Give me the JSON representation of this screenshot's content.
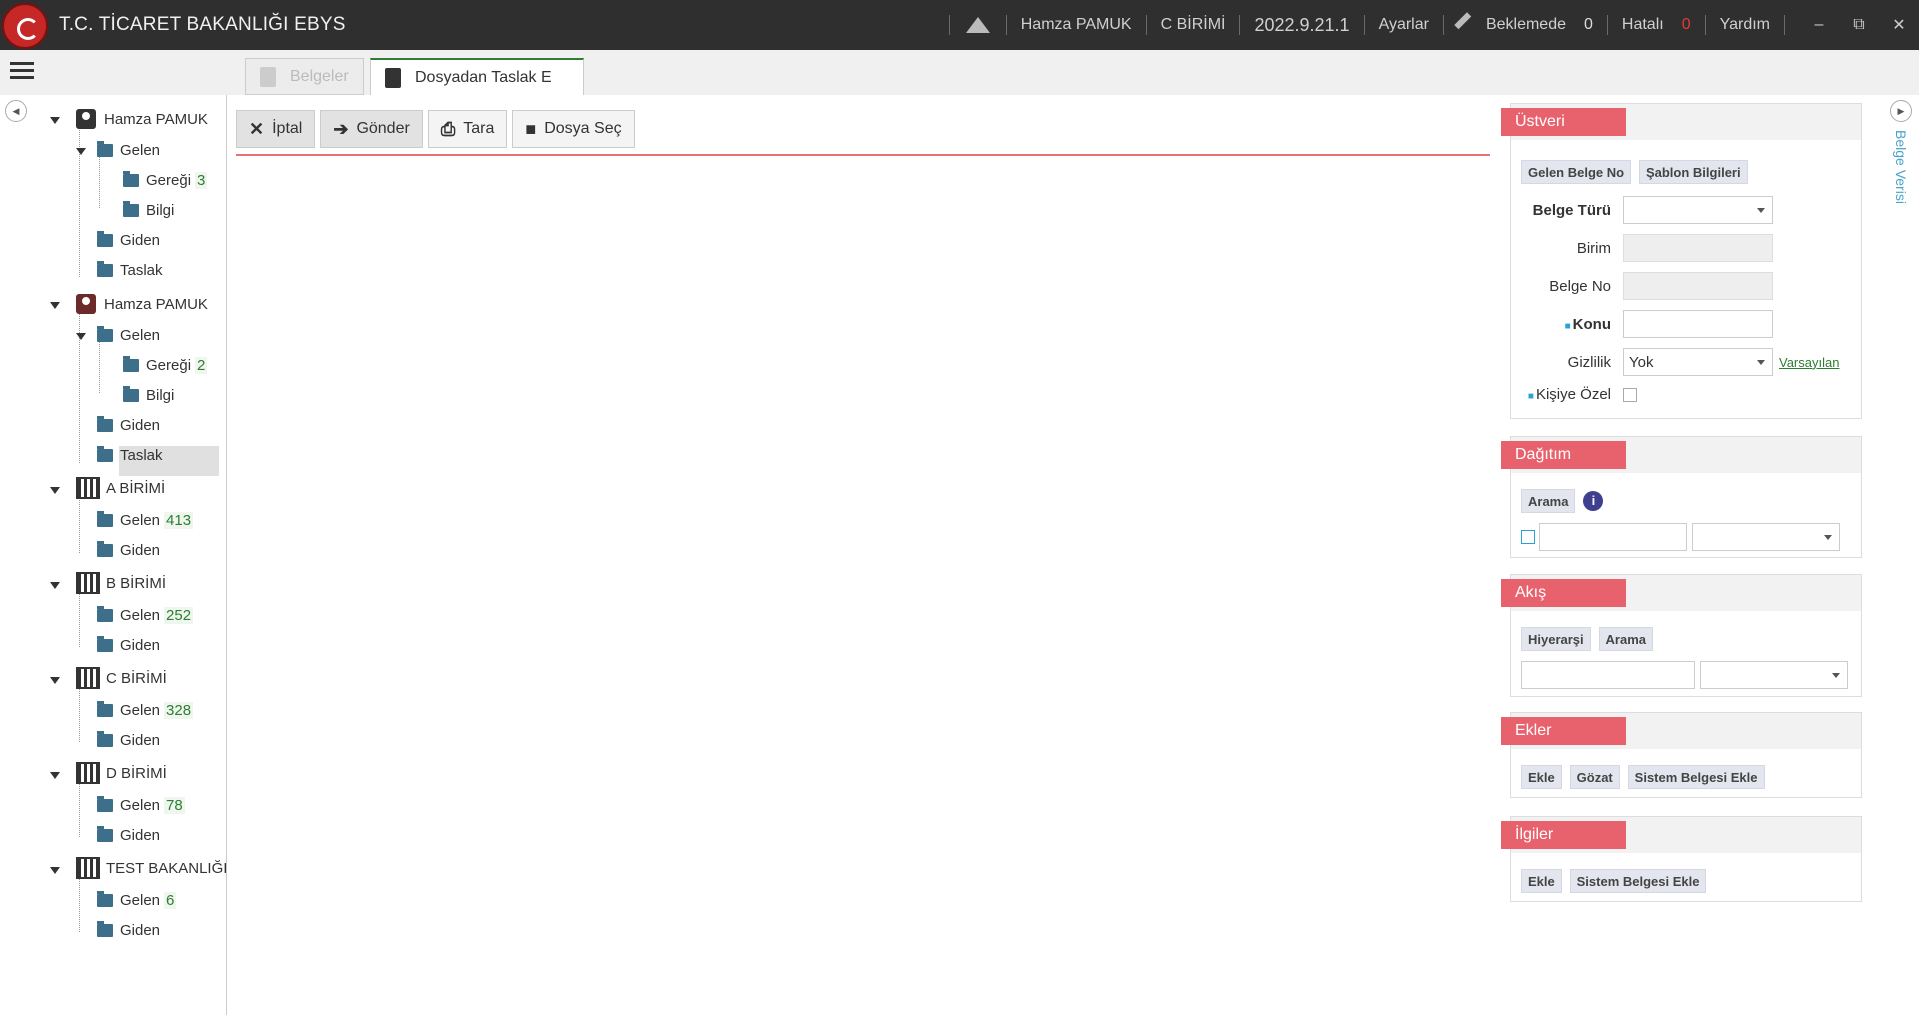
{
  "header": {
    "title": "T.C. TİCARET BAKANLIĞI EBYS",
    "user": "Hamza PAMUK",
    "unit": "C BİRİMİ",
    "version": "2022.9.21.1",
    "settings": "Ayarlar",
    "pending_label": "Beklemede",
    "pending_count": "0",
    "error_label": "Hatalı",
    "error_count": "0",
    "help": "Yardım",
    "minimize": "–",
    "restore": "⧉",
    "close": "✕"
  },
  "tabs": [
    {
      "label": "Belgeler"
    },
    {
      "label": "Dosyadan Taslak E"
    }
  ],
  "tree": {
    "user1": "Hamza PAMUK",
    "user2": "Hamza PAMUK",
    "gelen": "Gelen",
    "geregi": "Gereği",
    "bilgi": "Bilgi",
    "giden": "Giden",
    "taslak": "Taslak",
    "geregi1_count": "3",
    "geregi2_count": "2",
    "units": [
      {
        "name": "A BİRİMİ",
        "gelen_count": "413"
      },
      {
        "name": "B BİRİMİ",
        "gelen_count": "252"
      },
      {
        "name": "C BİRİMİ",
        "gelen_count": "328"
      },
      {
        "name": "D BİRİMİ",
        "gelen_count": "78"
      },
      {
        "name": "TEST BAKANLIĞI",
        "gelen_count": "6"
      }
    ]
  },
  "toolbar": {
    "cancel": "İptal",
    "send": "Gönder",
    "scan": "Tara",
    "choose_file": "Dosya Seç"
  },
  "metadata": {
    "title": "Üstveri",
    "chip1": "Gelen Belge No",
    "chip2": "Şablon Bilgileri",
    "doc_type": "Belge Türü",
    "unit": "Birim",
    "doc_no": "Belge No",
    "subject": "Konu",
    "privacy": "Gizlilik",
    "privacy_value": "Yok",
    "default_link": "Varsayılan",
    "personal": "Kişiye Özel"
  },
  "distribution": {
    "title": "Dağıtım",
    "search": "Arama"
  },
  "flow": {
    "title": "Akış",
    "hierarchy": "Hiyerarşi",
    "search": "Arama"
  },
  "attachments": {
    "title": "Ekler",
    "add": "Ekle",
    "browse": "Gözat",
    "add_system": "Sistem Belgesi Ekle"
  },
  "related": {
    "title": "İlgiler",
    "add": "Ekle",
    "add_system": "Sistem Belgesi Ekle"
  },
  "side_label": "Belge Verisi"
}
